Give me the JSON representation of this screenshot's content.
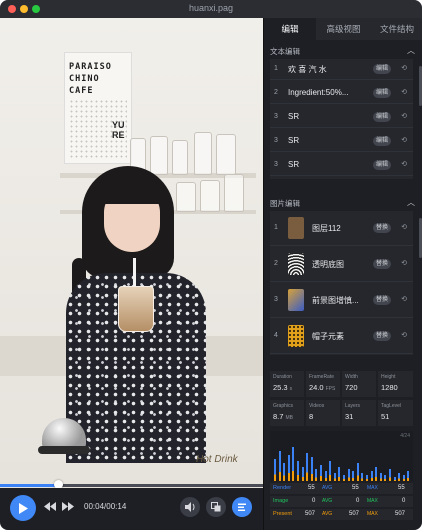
{
  "window": {
    "title": "huanxi.pag"
  },
  "tabs": [
    {
      "label": "编辑",
      "active": true
    },
    {
      "label": "高级视图",
      "active": false
    },
    {
      "label": "文件结构",
      "active": false
    }
  ],
  "text_section": {
    "title": "文本编辑",
    "edit_label": "编辑",
    "items": [
      {
        "index": "1",
        "name": "欢 喜 汽 水"
      },
      {
        "index": "2",
        "name": "Ingredient:50%..."
      },
      {
        "index": "3",
        "name": "SR"
      },
      {
        "index": "3",
        "name": "SR"
      },
      {
        "index": "3",
        "name": "SR"
      }
    ]
  },
  "image_section": {
    "title": "图片编辑",
    "replace_label": "替换",
    "items": [
      {
        "index": "1",
        "name": "图层112",
        "thumb_color": "#7a5c3e"
      },
      {
        "index": "2",
        "name": "透明底图",
        "thumb_color": "#f2f2f2"
      },
      {
        "index": "3",
        "name": "前景图增慎...",
        "thumb_color": "#d8a23a"
      },
      {
        "index": "4",
        "name": "帽子元素",
        "thumb_color": "#e2a11a"
      }
    ]
  },
  "stats": [
    {
      "label": "Duration",
      "value": "25.3",
      "unit": "s"
    },
    {
      "label": "FrameRate",
      "value": "24.0",
      "unit": "FPS"
    },
    {
      "label": "Width",
      "value": "720",
      "unit": ""
    },
    {
      "label": "Height",
      "value": "1280",
      "unit": ""
    },
    {
      "label": "Graphics",
      "value": "8.7",
      "unit": "MB"
    },
    {
      "label": "Videos",
      "value": "8",
      "unit": ""
    },
    {
      "label": "Layers",
      "value": "31",
      "unit": ""
    },
    {
      "label": "TagLevel",
      "value": "51",
      "unit": ""
    }
  ],
  "chart": {
    "label": "4/24"
  },
  "perf": [
    {
      "key": "Render",
      "color": "#3b82f6",
      "a": "55",
      "b": "55",
      "c": "55"
    },
    {
      "key": "Image",
      "color": "#22c55e",
      "a": "0",
      "b": "0",
      "c": "0"
    },
    {
      "key": "Present",
      "color": "#f59e0b",
      "a": "507",
      "b": "507",
      "c": "507"
    }
  ],
  "perf_tags": {
    "avg": "AVG",
    "max": "MAX"
  },
  "player": {
    "time": "00:04/00:14",
    "progress": 0.22
  },
  "poster": {
    "lines": [
      "PARAISO",
      "CHINO",
      "CAFE"
    ]
  },
  "sign": {
    "lines": [
      "YU",
      "RE"
    ]
  },
  "cup_sign": "Hot Drink",
  "colors": {
    "accent": "#3f88f6",
    "panel_bg": "#1d1f25"
  }
}
